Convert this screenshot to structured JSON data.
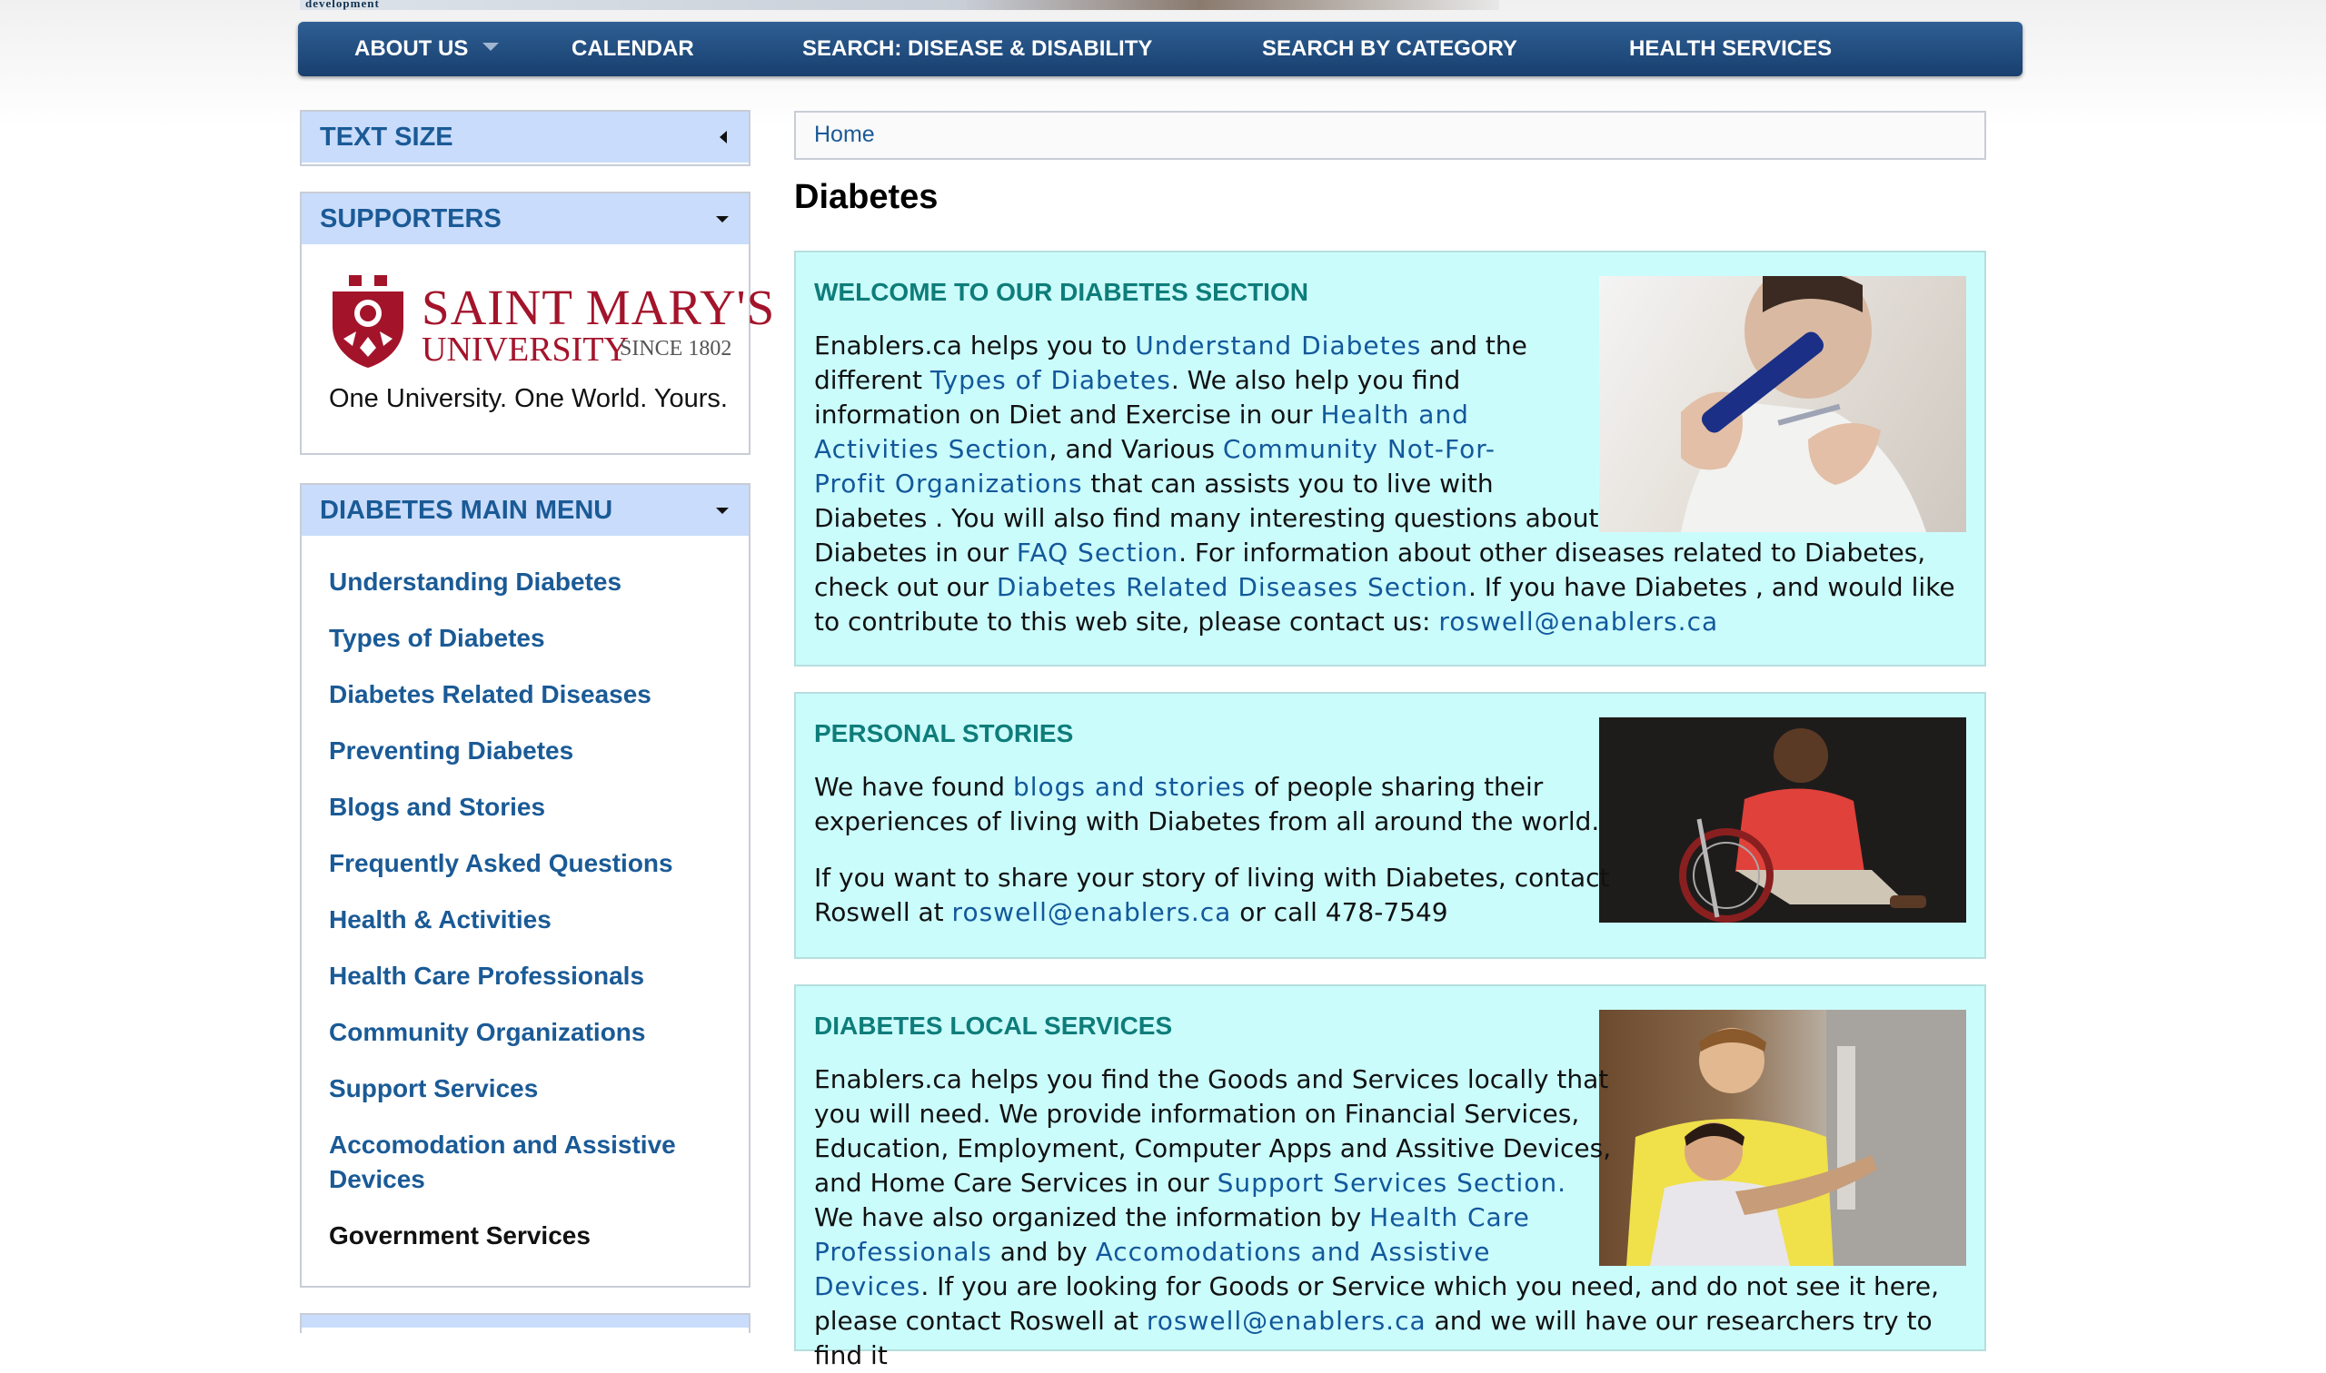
{
  "banner": {
    "fragment": "development"
  },
  "nav": {
    "items": [
      {
        "label": "ABOUT US",
        "has_dropdown": true
      },
      {
        "label": "CALENDAR"
      },
      {
        "label": "SEARCH: DISEASE & DISABILITY"
      },
      {
        "label": "SEARCH BY CATEGORY"
      },
      {
        "label": "HEALTH SERVICES"
      }
    ]
  },
  "sidebar": {
    "text_size": {
      "title": "TEXT SIZE"
    },
    "supporters": {
      "title": "SUPPORTERS",
      "logo": {
        "name_line1": "SAINT MARY'S",
        "name_line2": "UNIVERSITY",
        "since": "SINCE 1802",
        "tagline": "One University. One World. Yours."
      }
    },
    "diabetes_menu": {
      "title": "DIABETES MAIN MENU",
      "items": [
        "Understanding Diabetes",
        "Types of Diabetes",
        "Diabetes Related Diseases",
        "Preventing Diabetes",
        "Blogs and Stories",
        "Frequently Asked Questions",
        "Health & Activities",
        "Health Care Professionals",
        "Community Organizations",
        "Support Services",
        "Accomodation and Assistive",
        "Devices",
        "Government Services"
      ]
    }
  },
  "breadcrumb": {
    "home": "Home"
  },
  "page": {
    "title": "Diabetes"
  },
  "sections": {
    "welcome": {
      "title": "WELCOME TO OUR DIABETES SECTION",
      "t1": "Enablers.ca helps you to ",
      "l1": "Understand Diabetes",
      "t2": " and the",
      "t3": "different ",
      "l2": "Types of Diabetes",
      "t4": ". We also help you find",
      "t5": "information on Diet and Exercise in our ",
      "l3": "Health and",
      "l4": "Activities Section",
      "t6": ", and Various ",
      "l5": "Community Not-For-",
      "l6": "Profit Organizations",
      "t7": " that can assists you to live with",
      "t8": "Diabetes . You will also find many interesting questions about",
      "t9": "Diabetes in our ",
      "l7": "FAQ Section",
      "t10": ".  For information about other diseases related to Diabetes,",
      "t11": "check out our ",
      "l8": "Diabetes Related Diseases Section",
      "t12": ".  If you have Diabetes , and would like",
      "t13": "to contribute to this web site, please contact us: ",
      "l9": "roswell@enablers.ca"
    },
    "stories": {
      "title": "PERSONAL STORIES",
      "t1": "We have found ",
      "l1": "blogs and stories",
      "t2": " of people sharing their",
      "t3": "experiences of living with Diabetes from all around the world.",
      "t4": "If you want to share your story of living with Diabetes, contact",
      "t5": "Roswell at  ",
      "l2": "roswell@enablers.ca",
      "t6": "  or call 478-7549"
    },
    "local": {
      "title": "DIABETES LOCAL SERVICES",
      "t1": "Enablers.ca helps you find the Goods and Services locally that",
      "t2": "you will need.  We provide information on Financial Services,",
      "t3": "Education, Employment, Computer Apps and Assitive Devices,",
      "t4": "and Home Care Services in our ",
      "l1": "Support Services Section.",
      "t5": " We have also organized the information by ",
      "l2": "Health Care",
      "l3": "Professionals",
      "t6": " and by ",
      "l4": "Accomodations and Assistive",
      "l5": "Devices",
      "t7": ".  If you are looking for Goods or Service which you need, and do not see it here,",
      "t8": "please contact Roswell at ",
      "l6": "roswell@enablers.ca",
      "t9": "  and we will have our researchers try to find it"
    }
  },
  "colors": {
    "nav_bg": "#1f4a7d",
    "panel_head_bg": "#c9dcfb",
    "link": "#1a5a96",
    "box_bg": "#cbfcfc",
    "box_title": "#0e7d7a",
    "university_red": "#a3142b"
  }
}
